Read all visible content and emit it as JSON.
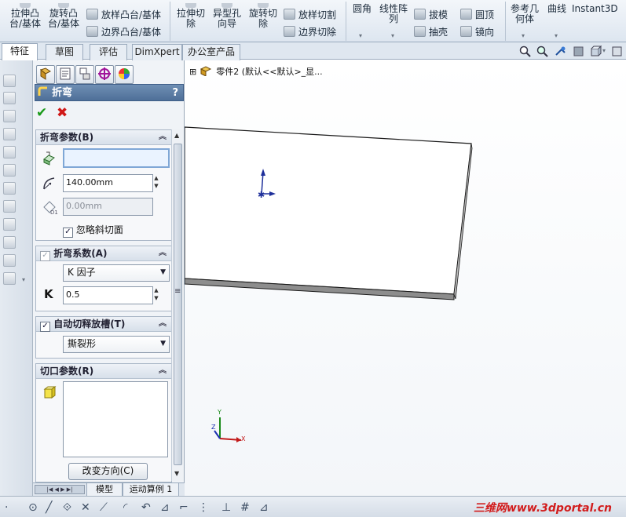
{
  "ribbon": {
    "large_buttons": [
      {
        "label_line1": "拉伸凸",
        "label_line2": "台/基体"
      },
      {
        "label_line1": "旋转凸",
        "label_line2": "台/基体"
      },
      {
        "label_line1": "拉伸切",
        "label_line2": "除"
      },
      {
        "label_line1": "异型孔",
        "label_line2": "向导"
      },
      {
        "label_line1": "旋转切",
        "label_line2": "除"
      },
      {
        "label_line1": "圆角",
        "label_line2": ""
      },
      {
        "label_line1": "线性阵",
        "label_line2": "列"
      },
      {
        "label_line1": "参考几",
        "label_line2": "何体"
      },
      {
        "label_line1": "曲线",
        "label_line2": ""
      },
      {
        "label_line1": "Instant3D",
        "label_line2": ""
      }
    ],
    "small_buttons": [
      {
        "label": "放样凸台/基体"
      },
      {
        "label": "边界凸台/基体"
      },
      {
        "label": "放样切割"
      },
      {
        "label": "边界切除"
      },
      {
        "label": "拔模"
      },
      {
        "label": "抽壳"
      },
      {
        "label": "圆顶"
      },
      {
        "label": "镜向"
      }
    ]
  },
  "tabs": [
    {
      "label": "特征"
    },
    {
      "label": "草图"
    },
    {
      "label": "评估"
    },
    {
      "label": "DimXpert"
    },
    {
      "label": "办公室产品"
    }
  ],
  "property_manager": {
    "title": "折弯",
    "help": "?",
    "ok": "✔",
    "cancel": "✖",
    "bend_params": {
      "header": "折弯参数(B)",
      "fixed_face_value": "",
      "radius_value": "140.00mm",
      "thickness_value": "0.00mm",
      "ignore_bevel_label": "忽略斜切面",
      "ignore_bevel_checked": true
    },
    "bend_allowance": {
      "header": "折弯系数(A)",
      "type_value": "K 因子",
      "k_label": "K",
      "k_value": "0.5"
    },
    "auto_relief": {
      "header": "自动切释放槽(T)",
      "checked": true,
      "type_value": "撕裂形"
    },
    "cut_params": {
      "header": "切口参数(R)",
      "change_direction": "改变方向(C)"
    }
  },
  "bottom_tabs": [
    {
      "label": "模型"
    },
    {
      "label": "运动算例 1"
    }
  ],
  "feature_tree": {
    "expander": "⊞",
    "text": "零件2  (默认<<默认>_显..."
  },
  "triad": {
    "x": "X",
    "y": "Y",
    "z": "Z"
  },
  "watermark": "三维网www.3dportal.cn"
}
